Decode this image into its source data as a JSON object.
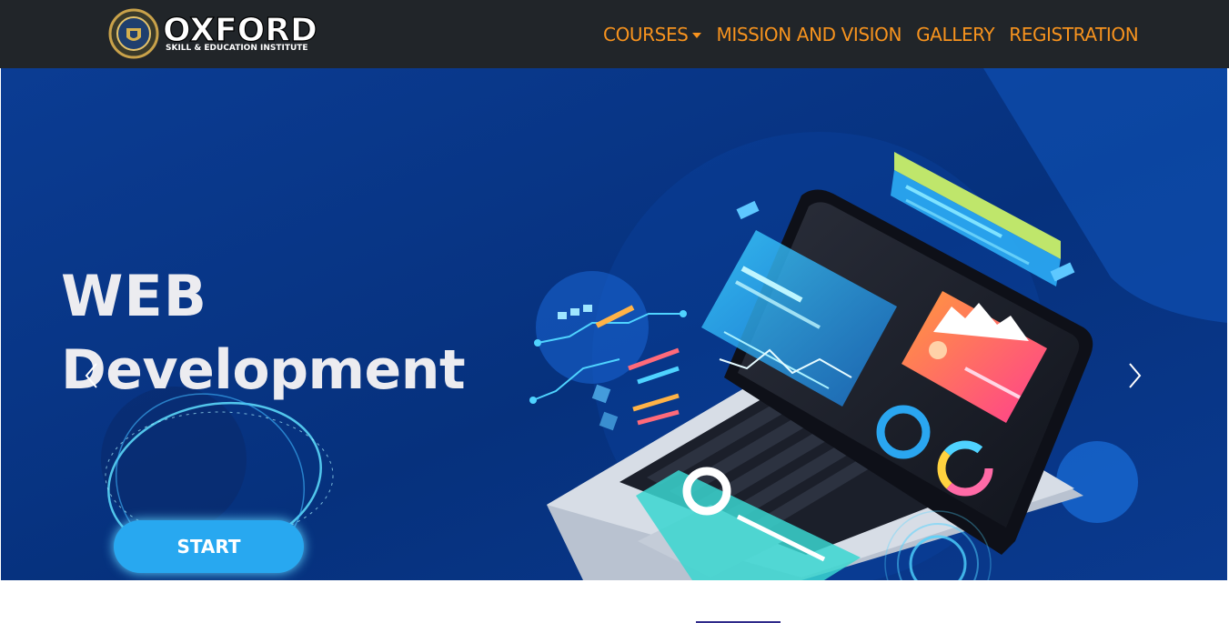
{
  "brand": {
    "title": "OXFORD",
    "subtitle": "SKILL & EDUCATION INSTITUTE",
    "logo": "oxford-crest-logo"
  },
  "nav": {
    "items": [
      {
        "label": "COURSES",
        "has_dropdown": true
      },
      {
        "label": "MISSION AND VISION",
        "has_dropdown": false
      },
      {
        "label": "GALLERY",
        "has_dropdown": false
      },
      {
        "label": "REGISTRATION",
        "has_dropdown": false
      }
    ]
  },
  "carousel": {
    "slide": {
      "line1": "WEB",
      "line2": "Development",
      "button": "START"
    },
    "prev_icon": "chevron-left-icon",
    "next_icon": "chevron-right-icon"
  },
  "colors": {
    "navbar_bg": "#212529",
    "nav_link": "#f7931e",
    "slide_bg": "#0a3a8f",
    "button": "#28a8f0",
    "accent_bar": "#2f2a8a"
  }
}
